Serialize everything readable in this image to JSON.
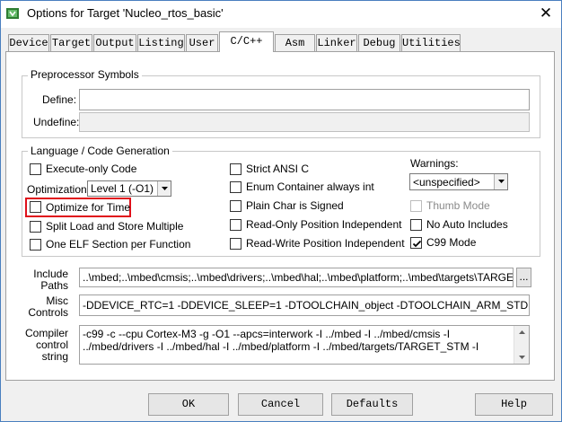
{
  "window": {
    "title": "Options for Target 'Nucleo_rtos_basic'",
    "close_glyph": "✕"
  },
  "tabs": [
    "Device",
    "Target",
    "Output",
    "Listing",
    "User",
    "C/C++",
    "Asm",
    "Linker",
    "Debug",
    "Utilities"
  ],
  "active_tab": "C/C++",
  "preprocessor": {
    "legend": "Preprocessor Symbols",
    "define_label": "Define:",
    "define_value": "",
    "undefine_label": "Undefine:",
    "undefine_value": ""
  },
  "language": {
    "legend": "Language / Code Generation",
    "execute_only": {
      "label": "Execute-only Code",
      "checked": false
    },
    "optimization_label": "Optimization:",
    "optimization_value": "Level 1 (-O1)",
    "optimize_time": {
      "label": "Optimize for Time",
      "checked": false
    },
    "split_load": {
      "label": "Split Load and Store Multiple",
      "checked": false
    },
    "one_elf": {
      "label": "One ELF Section per Function",
      "checked": false
    },
    "strict_ansi": {
      "label": "Strict ANSI C",
      "checked": false
    },
    "enum_container": {
      "label": "Enum Container always int",
      "checked": false
    },
    "plain_char": {
      "label": "Plain Char is Signed",
      "checked": false
    },
    "ro_pi": {
      "label": "Read-Only Position Independent",
      "checked": false
    },
    "rw_pi": {
      "label": "Read-Write Position Independent",
      "checked": false
    },
    "warnings_label": "Warnings:",
    "warnings_value": "<unspecified>",
    "thumb_mode": {
      "label": "Thumb Mode",
      "checked": false,
      "disabled": true
    },
    "no_auto_includes": {
      "label": "No Auto Includes",
      "checked": false
    },
    "c99_mode": {
      "label": "C99 Mode",
      "checked": true
    }
  },
  "include_paths": {
    "label": "Include\nPaths",
    "value": "..\\mbed;..\\mbed\\cmsis;..\\mbed\\drivers;..\\mbed\\hal;..\\mbed\\platform;..\\mbed\\targets\\TARGET_STM",
    "browse_label": "..."
  },
  "misc_controls": {
    "label": "Misc\nControls",
    "value": "-DDEVICE_RTC=1 -DDEVICE_SLEEP=1 -DTOOLCHAIN_object -DTOOLCHAIN_ARM_STD -D__ASSER"
  },
  "compiler_control": {
    "label": "Compiler\ncontrol\nstring",
    "value": "-c99 -c --cpu Cortex-M3 -g -O1 --apcs=interwork -I ../mbed -I ../mbed/cmsis -I ../mbed/drivers -I ../mbed/hal -I ../mbed/platform -I ../mbed/targets/TARGET_STM -I"
  },
  "buttons": {
    "ok": "OK",
    "cancel": "Cancel",
    "defaults": "Defaults",
    "help": "Help"
  },
  "colors": {
    "highlight_box": "#e0101a",
    "window_border": "#4a7fbf"
  }
}
